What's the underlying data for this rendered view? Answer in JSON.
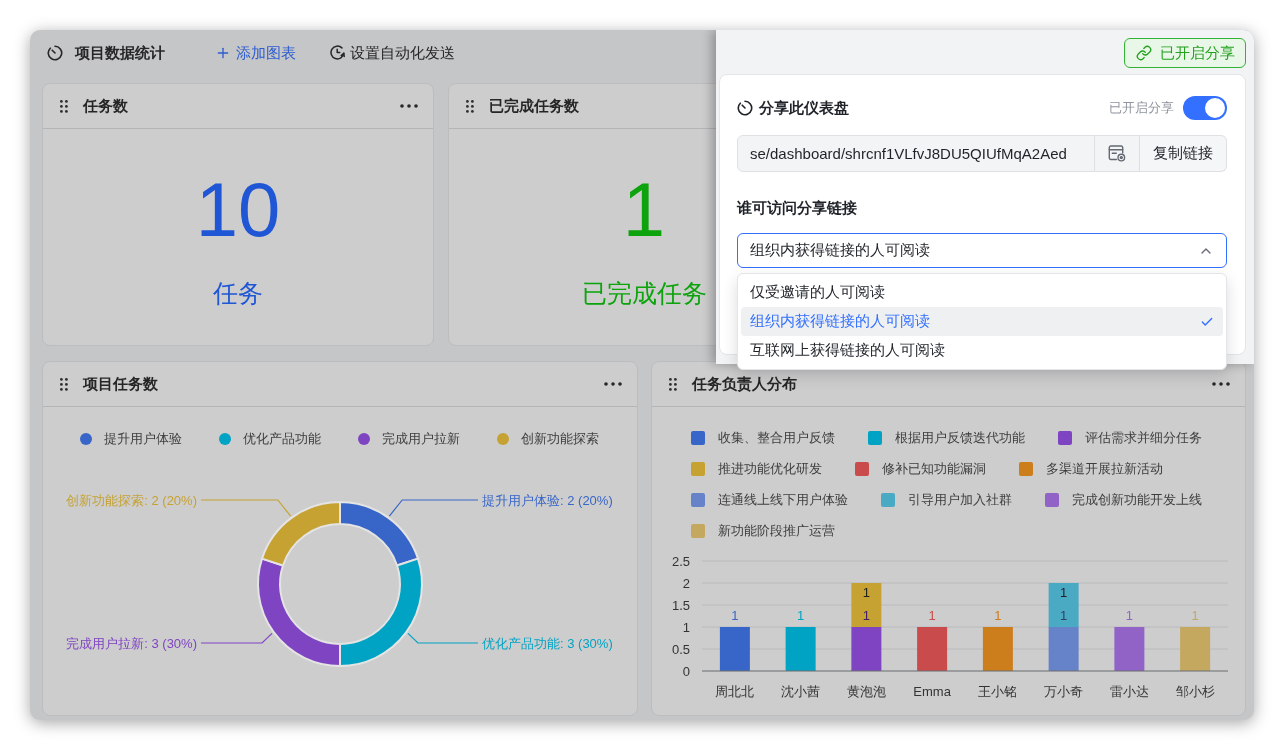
{
  "toolbar": {
    "title": "项目数据统计",
    "actions": [
      {
        "kind": "add",
        "label": "添加图表"
      },
      {
        "kind": "schedule",
        "label": "设置自动化发送"
      }
    ]
  },
  "stat_cards": [
    {
      "title": "任务数",
      "value": "10",
      "label": "任务",
      "color": "#1f56d6",
      "menu": true
    },
    {
      "title": "已完成任务数",
      "value": "1",
      "label": "已完成任务",
      "color": "#0ca30c"
    }
  ],
  "project_tasks": {
    "title": "项目任务数",
    "menu": true,
    "legend": [
      {
        "label": "提升用户体验",
        "color": "#3866c8"
      },
      {
        "label": "优化产品功能",
        "color": "#00a3c4"
      },
      {
        "label": "完成用户拉新",
        "color": "#7f44c2"
      },
      {
        "label": "创新功能探索",
        "color": "#c6a232"
      }
    ],
    "chart_data": {
      "type": "donut",
      "values": [
        2,
        3,
        3,
        2
      ],
      "value_labels": [
        "提升用户体验: 2 (20%)",
        "优化产品功能: 3 (30%)",
        "完成用户拉新: 3 (30%)",
        "创新功能探索: 2 (20%)"
      ]
    }
  },
  "assignee_chart": {
    "title": "任务负责人分布",
    "menu": true,
    "chart_data": {
      "type": "bar",
      "stacked": true,
      "grid": true,
      "categories": [
        "周北北",
        "沈小茜",
        "黄泡泡",
        "Emma",
        "王小铭",
        "万小奇",
        "雷小达",
        "邹小杉"
      ],
      "series": [
        {
          "name": "收集、整合用户反馈",
          "color": "#3866c8",
          "values": [
            1,
            null,
            null,
            null,
            null,
            null,
            null,
            null
          ]
        },
        {
          "name": "根据用户反馈迭代功能",
          "color": "#00a3c4",
          "values": [
            null,
            1,
            null,
            null,
            null,
            null,
            null,
            null
          ]
        },
        {
          "name": "评估需求并细分任务",
          "color": "#7f44c2",
          "values": [
            null,
            null,
            1,
            null,
            null,
            null,
            null,
            null
          ]
        },
        {
          "name": "推进功能优化研发",
          "color": "#c6a232",
          "values": [
            null,
            null,
            1,
            null,
            null,
            null,
            null,
            null
          ]
        },
        {
          "name": "修补已知功能漏洞",
          "color": "#c94b4b",
          "values": [
            null,
            null,
            null,
            1,
            null,
            null,
            null,
            null
          ]
        },
        {
          "name": "多渠道开展拉新活动",
          "color": "#cc7d1c",
          "values": [
            null,
            null,
            null,
            null,
            1,
            null,
            null,
            null
          ]
        },
        {
          "name": "连通线上线下用户体验",
          "color": "#6682c8",
          "values": [
            null,
            null,
            null,
            null,
            null,
            1,
            null,
            null
          ]
        },
        {
          "name": "引导用户加入社群",
          "color": "#4aaac4",
          "values": [
            null,
            null,
            null,
            null,
            null,
            1,
            null,
            null
          ]
        },
        {
          "name": "完成创新功能开发上线",
          "color": "#9163c6",
          "values": [
            null,
            null,
            null,
            null,
            null,
            null,
            1,
            null
          ]
        },
        {
          "name": "新功能阶段推广运营",
          "color": "#c4a860",
          "values": [
            null,
            null,
            null,
            null,
            null,
            null,
            null,
            1
          ]
        }
      ],
      "ylim": [
        0,
        2.5
      ],
      "yticks": [
        0,
        0.5,
        1,
        1.5,
        2,
        2.5
      ],
      "data_labels": true
    }
  },
  "share_panel": {
    "status_button": "已开启分享",
    "title": "分享此仪表盘",
    "toggle_label": "已开启分享",
    "toggle_on": true,
    "link": {
      "value": "se/dashboard/shrcnf1VLfvJ8DU5QIUfMqA2Aed",
      "copy_button": "复制链接"
    },
    "access_label": "谁可访问分享链接",
    "access_select": {
      "value": "组织内获得链接的人可阅读",
      "expanded": true,
      "options": [
        {
          "label": "仅受邀请的人可阅读",
          "selected": false
        },
        {
          "label": "组织内获得链接的人可阅读",
          "selected": true
        },
        {
          "label": "互联网上获得链接的人可阅读",
          "selected": false
        }
      ]
    }
  }
}
